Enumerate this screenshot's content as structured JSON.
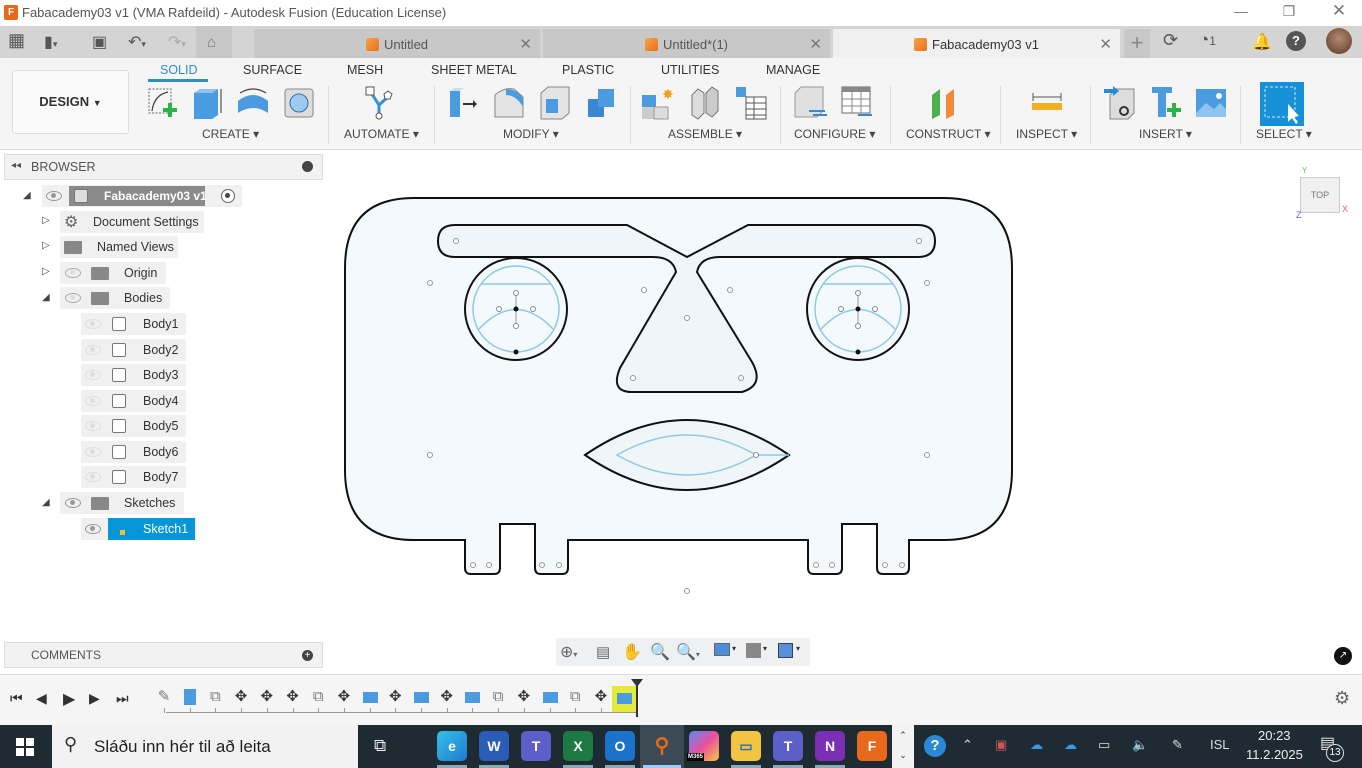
{
  "window": {
    "title": "Fabacademy03 v1 (VMA Rafdeild) - Autodesk Fusion (Education License)",
    "controls": [
      "minimize",
      "restore",
      "close"
    ]
  },
  "tabs": [
    {
      "label": "Untitled",
      "active": false
    },
    {
      "label": "Untitled*(1)",
      "active": false
    },
    {
      "label": "Fabacademy03 v1",
      "active": true
    }
  ],
  "tabbar_right": {
    "job_count": "1"
  },
  "workspace": {
    "label": "DESIGN"
  },
  "ribbon_tabs": [
    "SOLID",
    "SURFACE",
    "MESH",
    "SHEET METAL",
    "PLASTIC",
    "UTILITIES",
    "MANAGE"
  ],
  "ribbon_groups": [
    "CREATE",
    "AUTOMATE",
    "MODIFY",
    "ASSEMBLE",
    "CONFIGURE",
    "CONSTRUCT",
    "INSPECT",
    "INSERT",
    "SELECT"
  ],
  "browser": {
    "title": "BROWSER",
    "root": "Fabacademy03 v1",
    "items": [
      {
        "label": "Document Settings",
        "icon": "gear-icon"
      },
      {
        "label": "Named Views",
        "icon": "folder-icon"
      },
      {
        "label": "Origin",
        "icon": "folder-icon"
      },
      {
        "label": "Bodies",
        "icon": "folder-icon"
      }
    ],
    "bodies": [
      "Body1",
      "Body2",
      "Body3",
      "Body4",
      "Body5",
      "Body6",
      "Body7"
    ],
    "sketches_label": "Sketches",
    "sketches": [
      "Sketch1"
    ]
  },
  "viewcube": {
    "face": "TOP"
  },
  "comments": {
    "title": "COMMENTS"
  },
  "timeline": {
    "feature_count": 19
  },
  "taskbar": {
    "search_placeholder": "Sláðu inn hér til að leita",
    "apps": [
      "Edge",
      "Word",
      "Teams",
      "Excel",
      "Outlook",
      "Fusion",
      "M365",
      "File Explorer",
      "Teams (work)",
      "OneNote",
      "Fusion (F)"
    ],
    "m365_label": "M365",
    "language": "ISL",
    "time": "20:23",
    "date": "11.2.2025",
    "notifications": "13"
  },
  "colors": {
    "accent": "#2a8fc9",
    "selected": "#0696d7",
    "sketch_line": "#8ecae6",
    "fill": "#f4f9fd"
  }
}
